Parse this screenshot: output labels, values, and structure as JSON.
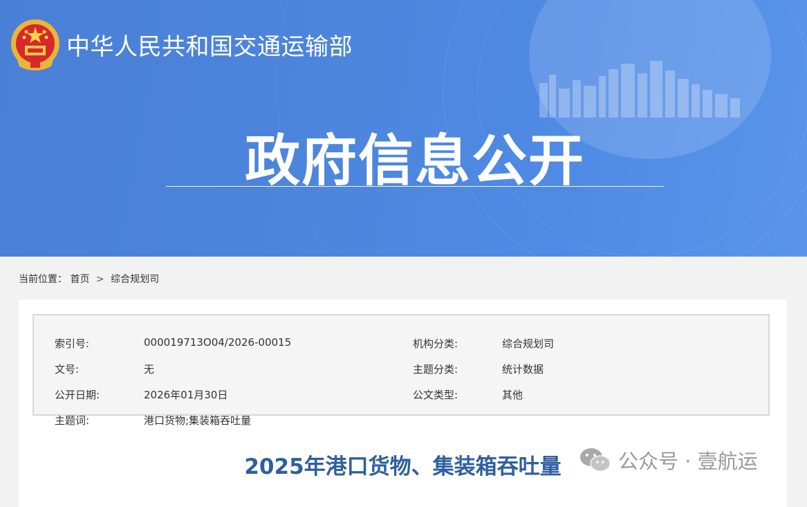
{
  "header": {
    "org_name": "中华人民共和国交通运输部",
    "section_title": "政府信息公开",
    "emblem_icon": "national-emblem-icon",
    "colors": {
      "banner": "#4d86dd",
      "title_text": "#2e5f9e"
    }
  },
  "breadcrumb": {
    "prefix": "当前位置：",
    "home": "首页",
    "separator": ">",
    "current": "综合规划司"
  },
  "meta": {
    "rows": [
      {
        "label_left": "索引号:",
        "value_left": "000019713O04/2026-00015",
        "label_right": "机构分类:",
        "value_right": "综合规划司"
      },
      {
        "label_left": "文号:",
        "value_left": "无",
        "label_right": "主题分类:",
        "value_right": "统计数据"
      },
      {
        "label_left": "公开日期:",
        "value_left": "2026年01月30日",
        "label_right": "公文类型:",
        "value_right": "其他"
      },
      {
        "label_left": "主题词:",
        "value_left": "港口货物;集装箱吞吐量",
        "label_right": "",
        "value_right": ""
      }
    ]
  },
  "document": {
    "title": "2025年港口货物、集装箱吞吐量"
  },
  "watermark": {
    "text": "公众号 · 壹航运",
    "icon": "wechat-icon"
  }
}
